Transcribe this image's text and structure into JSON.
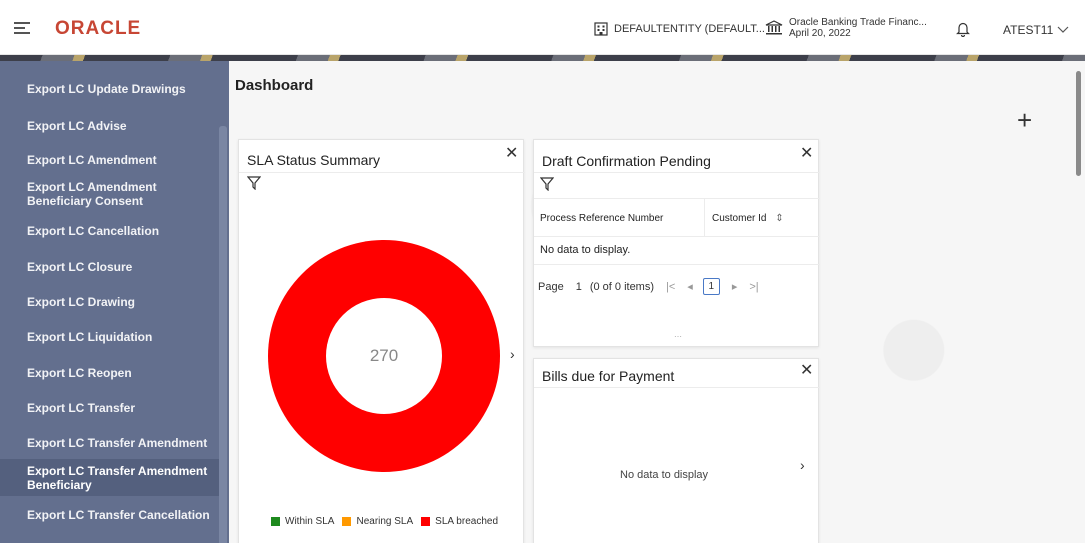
{
  "header": {
    "logo": "ORACLE",
    "entity": "DEFAULTENTITY (DEFAULT...",
    "app_name": "Oracle Banking Trade Financ...",
    "app_date": "April 20, 2022",
    "user": "ATEST11"
  },
  "sidebar": {
    "items": [
      {
        "label": "Export LC Update Drawings"
      },
      {
        "label": "Export LC Advise"
      },
      {
        "label": "Export LC Amendment"
      },
      {
        "label": "Export LC Amendment Beneficiary Consent"
      },
      {
        "label": "Export LC Cancellation"
      },
      {
        "label": "Export LC Closure"
      },
      {
        "label": "Export LC Drawing"
      },
      {
        "label": "Export LC Liquidation"
      },
      {
        "label": "Export LC Reopen"
      },
      {
        "label": "Export LC Transfer"
      },
      {
        "label": "Export LC Transfer Amendment"
      },
      {
        "label": "Export LC Transfer Amendment Beneficiary"
      },
      {
        "label": "Export LC Transfer Cancellation"
      }
    ]
  },
  "main": {
    "title": "Dashboard",
    "add_symbol": "+"
  },
  "sla_card": {
    "title": "SLA Status Summary",
    "total": "270",
    "legend": [
      {
        "label": "Within SLA",
        "color": "#1e8a1e"
      },
      {
        "label": "Nearing SLA",
        "color": "#ff9900"
      },
      {
        "label": "SLA breached",
        "color": "#ff0000"
      }
    ]
  },
  "draft_card": {
    "title": "Draft Confirmation Pending",
    "columns": [
      "Process Reference Number",
      "Customer Id"
    ],
    "empty_text": "No data to display.",
    "pager": {
      "page_label": "Page",
      "page_number": "1",
      "items_text": "(0 of 0 items)",
      "current_page": "1"
    }
  },
  "bills_card": {
    "title": "Bills due for Payment",
    "empty_text": "No data to display"
  },
  "colors": {
    "brand": "#c74634",
    "sidebar": "#636f8e",
    "breached": "#ff0000"
  }
}
